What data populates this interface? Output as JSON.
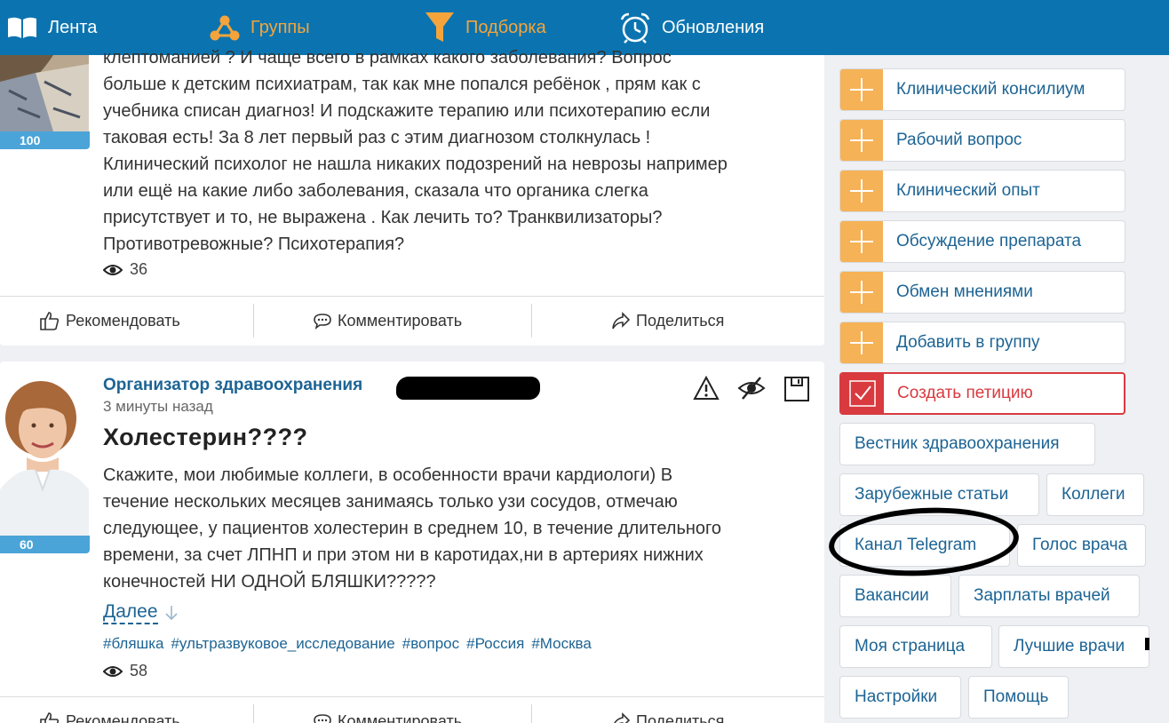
{
  "nav": {
    "items": [
      {
        "label": "Лента",
        "icon": "book-icon"
      },
      {
        "label": "Группы",
        "icon": "network-icon"
      },
      {
        "label": "Подборка",
        "icon": "filter-icon"
      },
      {
        "label": "Обновления",
        "icon": "alarm-clock-icon"
      }
    ]
  },
  "post1": {
    "avatar_badge": "100",
    "text_lines": [
      "клептоманией ? И чаще всего в рамках какого заболевания? Вопрос",
      "больше к детским психиатрам, так как мне попался ребёнок , прям как с",
      "учебника списан диагноз! И подскажите терапию или психотерапию если",
      "таковая есть! За 8 лет первый раз с этим диагнозом столкнулась !",
      "Клинический психолог не нашла никаких подозрений на неврозы например",
      "или ещё на какие либо заболевания, сказала что органика слегка",
      "присутствует и то, не выражена . Как лечить то? Транквилизаторы?",
      "Противотревожные? Психотерапия?"
    ],
    "views": "36"
  },
  "actions": {
    "recommend": "Рекомендовать",
    "comment": "Комментировать",
    "share": "Поделиться"
  },
  "post2": {
    "avatar_badge": "60",
    "author": "Организатор здравоохранения",
    "time": "3 минуты назад",
    "title": "Холестерин????",
    "text_lines": [
      "Скажите, мои любимые коллеги, в особенности врачи кардиологи) В",
      "течение нескольких месяцев занимаясь только узи сосудов, отмечаю",
      "следующее, у пациентов холестерин в среднем 10, в течение длительного",
      "времени, за счет ЛПНП и при этом ни в каротидах,ни в артериях нижних",
      "конечностей НИ ОДНОЙ БЛЯШКИ?????"
    ],
    "more": "Далее",
    "tags": [
      "#бляшка",
      "#ультразвуковое_исследование",
      "#вопрос",
      "#Россия",
      "#Москва"
    ],
    "views": "58"
  },
  "sidebar": {
    "plus_buttons": [
      "Клинический консилиум",
      "Рабочий вопрос",
      "Клинический опыт",
      "Обсуждение препарата",
      "Обмен мнениями",
      "Добавить в группу"
    ],
    "petition": "Создать петицию",
    "links": {
      "vestnik": "Вестник здравоохранения",
      "foreign": "Зарубежные статьи",
      "colleagues": "Коллеги",
      "telegram": "Канал Telegram",
      "voice": "Голос врача",
      "vacancies": "Вакансии",
      "salaries": "Зарплаты врачей",
      "my_page": "Моя страница",
      "best_doctors": "Лучшие врачи",
      "settings": "Настройки",
      "help": "Помощь"
    }
  },
  "colors": {
    "nav_bg": "#0b74b0",
    "accent_orange": "#f5a43b",
    "link_blue": "#1d6494",
    "petition_red": "#d83a3f",
    "badge_blue": "#4aa4d8"
  }
}
